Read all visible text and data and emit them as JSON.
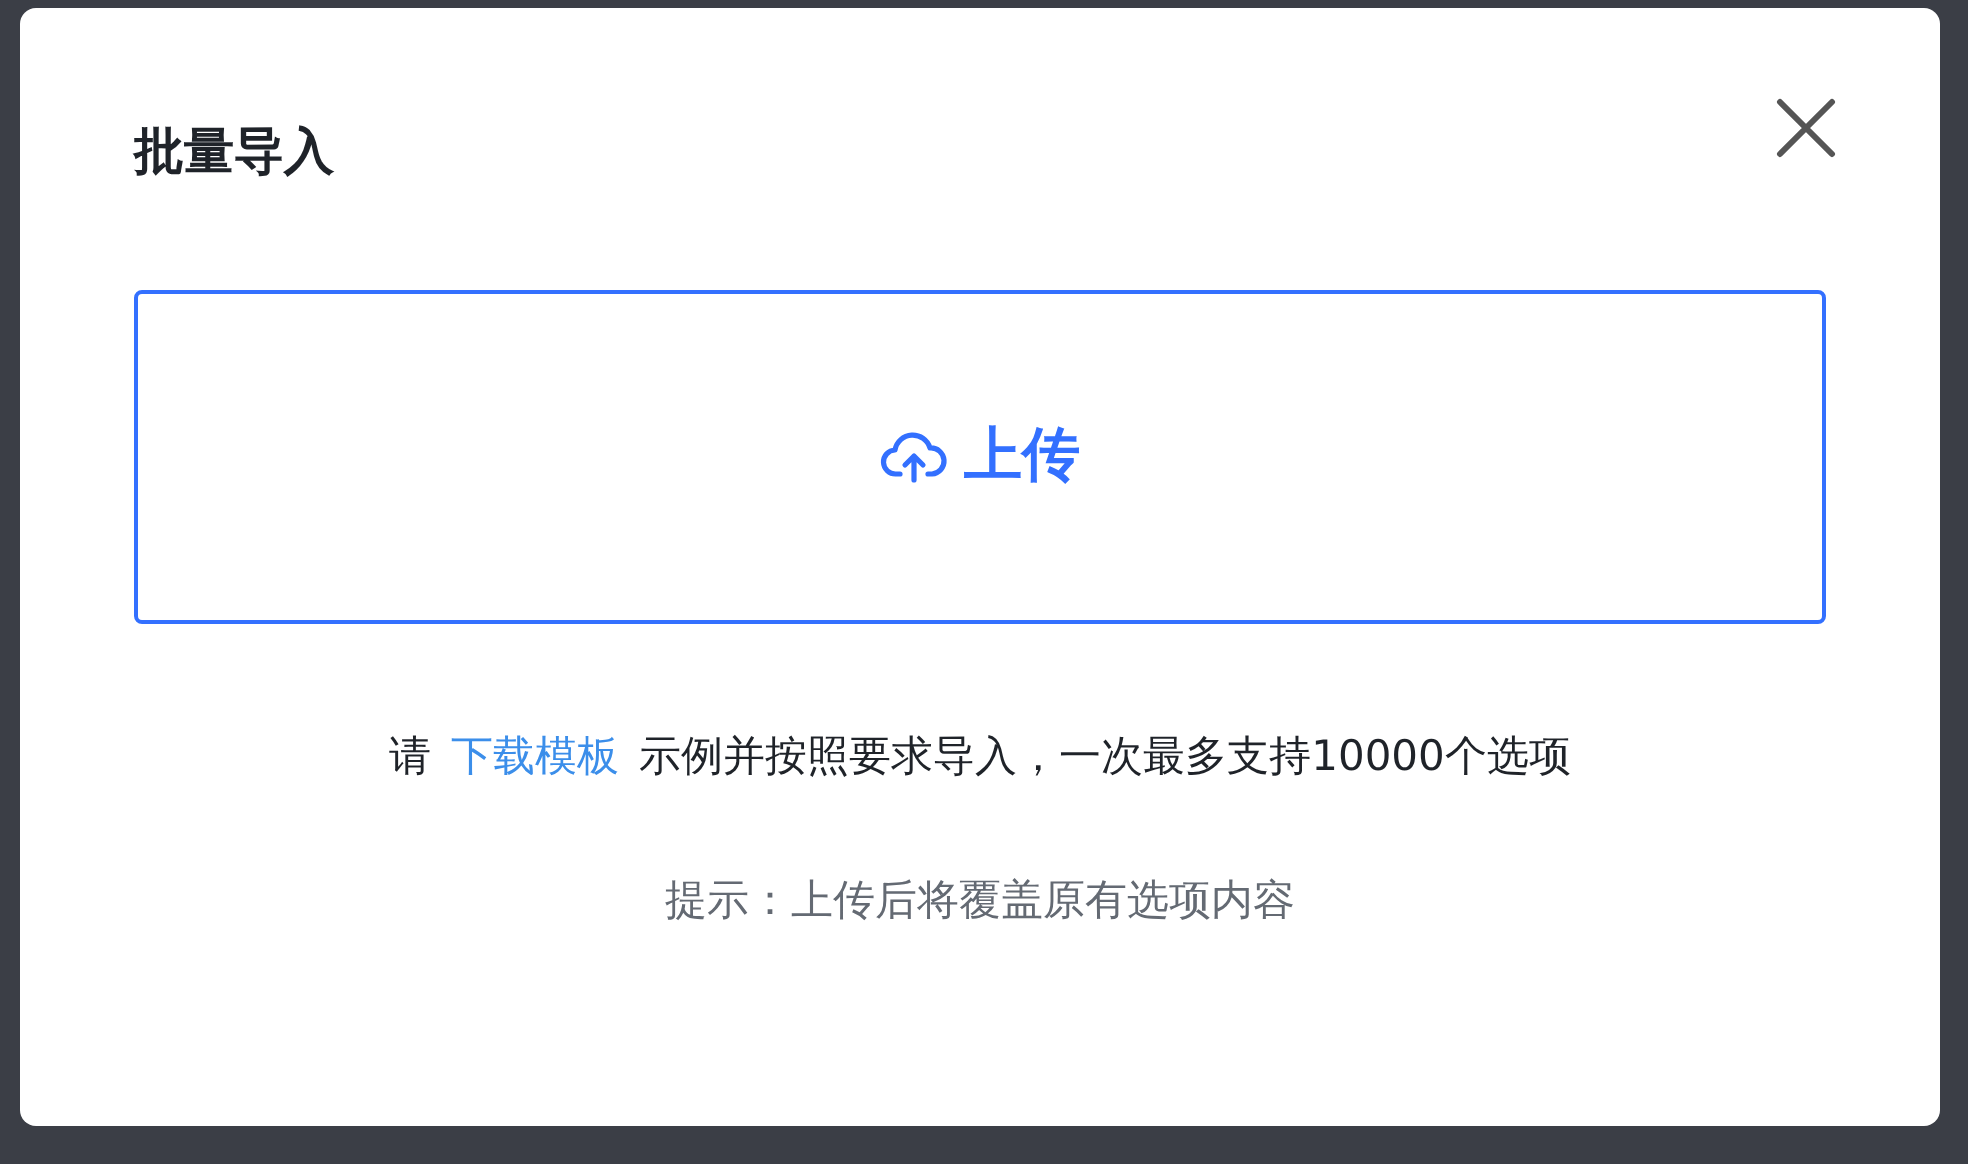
{
  "dialog": {
    "title": "批量导入"
  },
  "upload": {
    "label": "上传"
  },
  "instruction": {
    "prefix": "请",
    "link": "下载模板",
    "suffix": "示例并按照要求导入，一次最多支持10000个选项"
  },
  "hint": "提示：上传后将覆盖原有选项内容"
}
